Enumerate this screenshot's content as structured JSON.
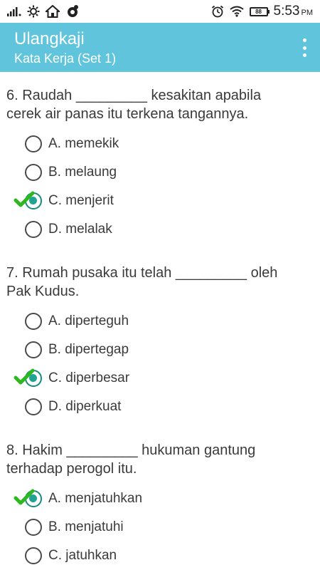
{
  "statusbar": {
    "time": "5:53",
    "ampm": "PM",
    "battery": "88",
    "icons": [
      "signal-icon",
      "notification-icon",
      "home-icon",
      "badge-icon",
      "alarm-icon",
      "wifi-icon",
      "battery-icon"
    ]
  },
  "appbar": {
    "title": "Ulangkaji",
    "subtitle": "Kata Kerja  (Set 1)",
    "background": "#5fc4dc",
    "menu_icon": "overflow-menu-icon"
  },
  "accent": {
    "radio_checked": "#21a394",
    "check_mark": "#2db81f"
  },
  "questions": [
    {
      "text": "6. Raudah _________ kesakitan apabila\ncerek air panas itu terkena tangannya.",
      "options": [
        {
          "label": "A. memekik",
          "selected": false
        },
        {
          "label": "B. melaung",
          "selected": false
        },
        {
          "label": "C. menjerit",
          "selected": true
        },
        {
          "label": "D. melalak",
          "selected": false
        }
      ]
    },
    {
      "text": "7. Rumah pusaka itu telah _________ oleh\nPak Kudus.",
      "options": [
        {
          "label": "A. diperteguh",
          "selected": false
        },
        {
          "label": "B. dipertegap",
          "selected": false
        },
        {
          "label": "C. diperbesar",
          "selected": true
        },
        {
          "label": "D. diperkuat",
          "selected": false
        }
      ]
    },
    {
      "text": "8. Hakim _________ hukuman gantung\nterhadap perogol itu.",
      "options": [
        {
          "label": "A. menjatuhkan",
          "selected": true
        },
        {
          "label": "B. menjatuhi",
          "selected": false
        },
        {
          "label": "C. jatuhkan",
          "selected": false
        }
      ]
    }
  ]
}
